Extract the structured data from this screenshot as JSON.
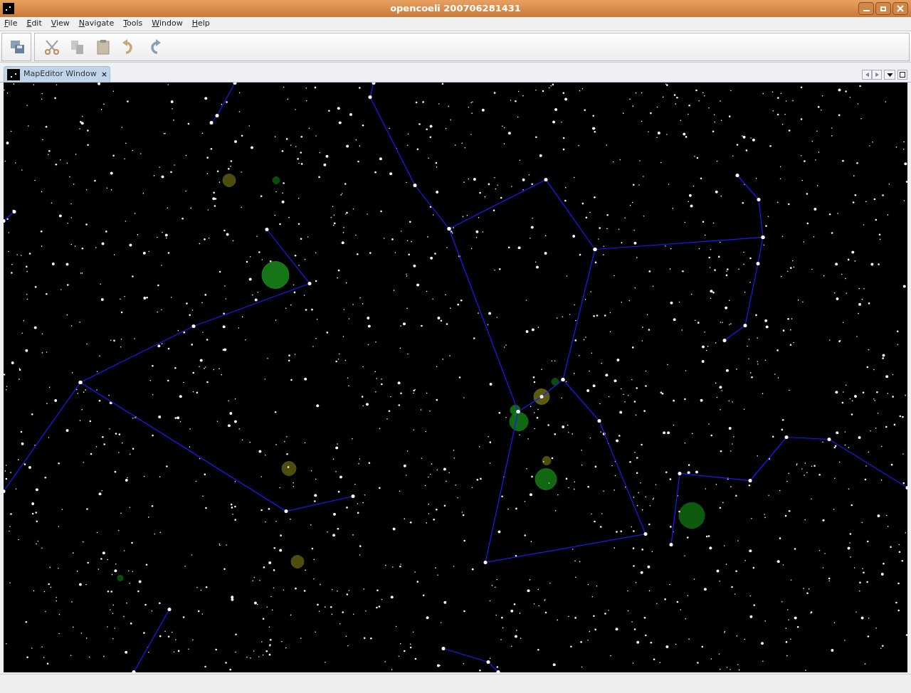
{
  "window": {
    "title": "opencoeli 200706281431"
  },
  "menu": [
    {
      "label": "File"
    },
    {
      "label": "Edit"
    },
    {
      "label": "View"
    },
    {
      "label": "Navigate"
    },
    {
      "label": "Tools"
    },
    {
      "label": "Window"
    },
    {
      "label": "Help"
    }
  ],
  "tabs": [
    {
      "label": "MapEditor Window",
      "selected": true
    }
  ]
}
